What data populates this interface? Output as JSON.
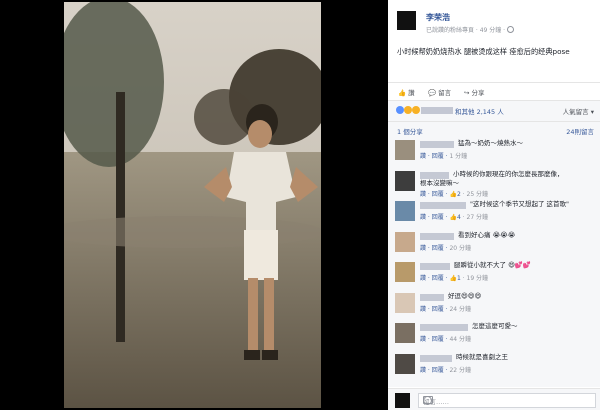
{
  "post": {
    "author": "李荣浩",
    "meta": "已說讚的粉絲專頁 · 49 分鐘 ·",
    "caption": "小时候帮奶奶烧热水 腿被烫成这样 痊愈后的经典pose"
  },
  "actions": {
    "like": "讚",
    "comment": "留言",
    "share": "分享"
  },
  "reactions": {
    "summary": "和其他 2,145 人",
    "sort": "人氣留言"
  },
  "shares": {
    "count": "1 個分享",
    "comments": "24則留言"
  },
  "comments": [
    {
      "text": "猛為～奶奶～燒熱水～",
      "meta_pre": "讚 · 回覆 · ",
      "meta_time": "1 分鐘"
    },
    {
      "text": "小時候的你跟現在的你怎麼長那麼像，",
      "text2": "根本沒變嘛～",
      "meta_pre": "讚 · 回覆 · ",
      "likes": "2",
      "meta_time": "25 分鐘"
    },
    {
      "text": "\"这时候这个季节又想起了 这首歌\"",
      "meta_pre": "讚 · 回覆 · ",
      "likes": "4",
      "meta_time": "27 分鐘"
    },
    {
      "text": "看到好心痛 😭😭😭",
      "meta_pre": "讚 · 回覆 · ",
      "meta_time": "20 分鐘"
    },
    {
      "text": "腿瞬從小就不大了 😄💕💕",
      "meta_pre": "讚 · 回覆 · ",
      "likes": "1",
      "meta_time": "19 分鐘"
    },
    {
      "text": "好逗😄😄😄",
      "meta_pre": "讚 · 回覆 · ",
      "meta_time": "24 分鐘"
    },
    {
      "text": "怎麼這麼可愛～",
      "meta_pre": "讚 · 回覆 · ",
      "meta_time": "44 分鐘"
    },
    {
      "text": "時候就是喜劇之王",
      "meta_pre": "讚 · 回覆 · ",
      "meta_time": "22 分鐘"
    }
  ],
  "footer": {
    "placeholder": "留言……"
  },
  "colors": {
    "link": "#365899",
    "panel_bg": "#f6f7f9"
  }
}
